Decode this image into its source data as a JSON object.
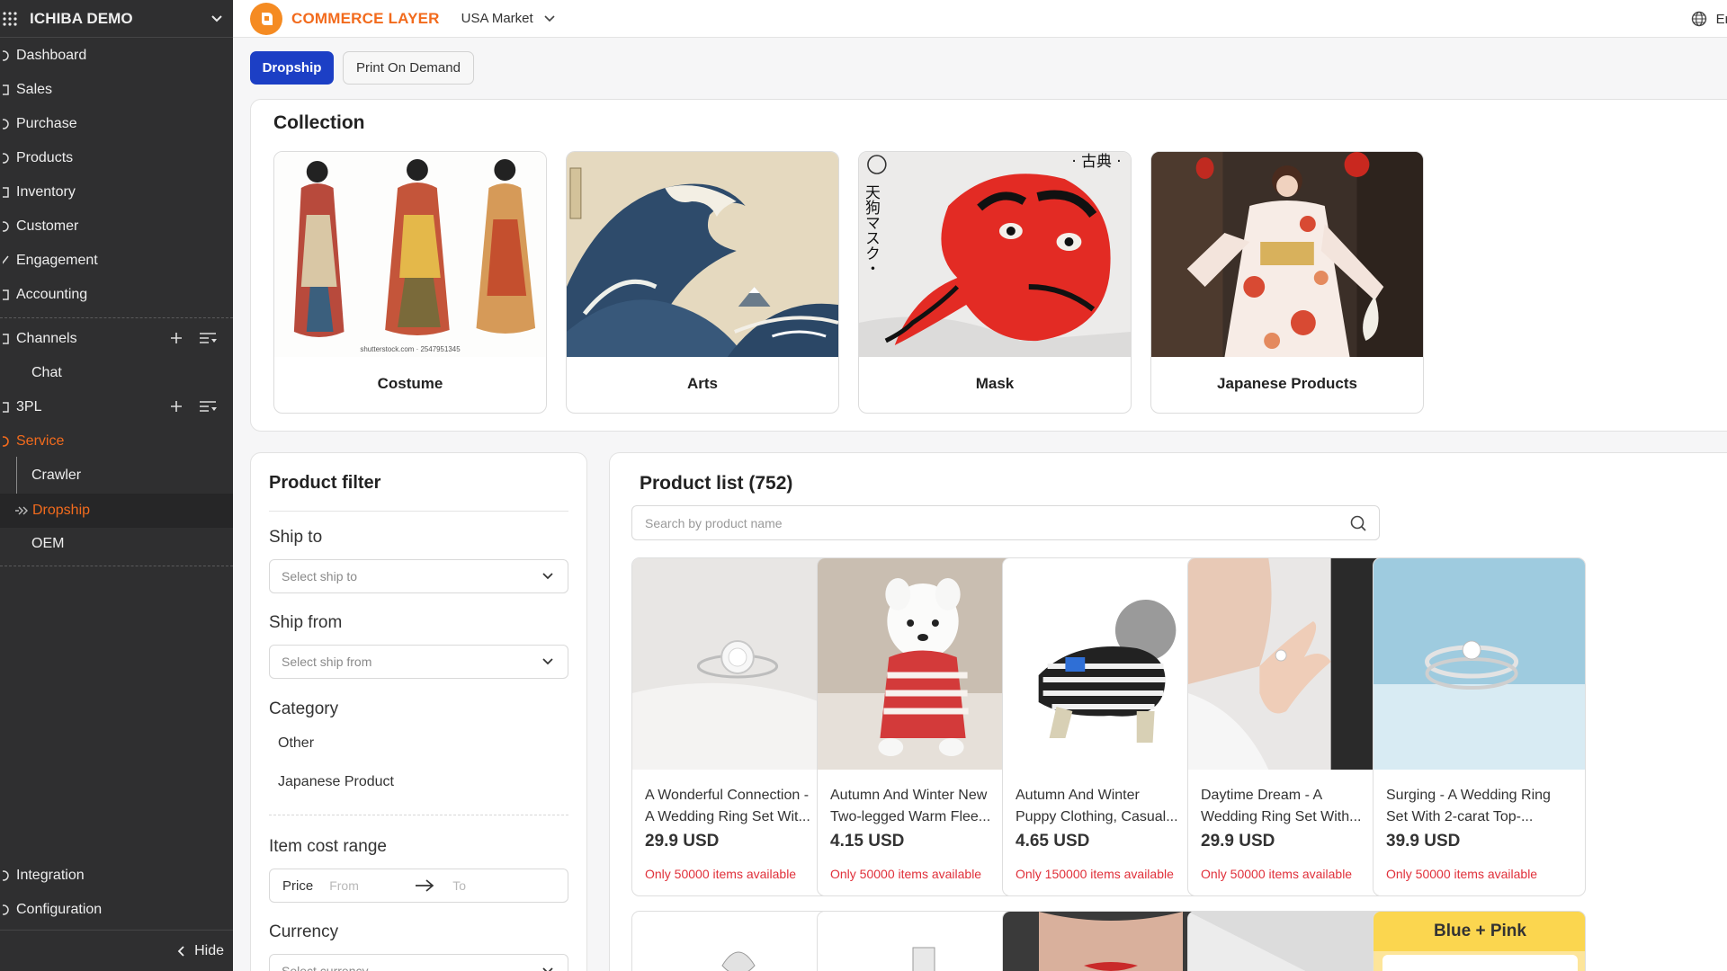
{
  "sidebar": {
    "workspace": "ICHIBA DEMO",
    "items": [
      {
        "label": "Dashboard"
      },
      {
        "label": "Sales"
      },
      {
        "label": "Purchase"
      },
      {
        "label": "Products"
      },
      {
        "label": "Inventory"
      },
      {
        "label": "Customer"
      },
      {
        "label": "Engagement"
      },
      {
        "label": "Accounting"
      }
    ],
    "channels": {
      "label": "Channels",
      "children": [
        "Chat"
      ]
    },
    "tpl": {
      "label": "3PL"
    },
    "service": {
      "label": "Service",
      "children": [
        "Crawler",
        "Dropship",
        "OEM"
      ]
    },
    "bottom": [
      {
        "label": "Integration"
      },
      {
        "label": "Configuration"
      }
    ],
    "hide_label": "Hide"
  },
  "topbar": {
    "brand": "COMMERCE LAYER",
    "market": "USA Market",
    "language": "En"
  },
  "tabs": [
    {
      "label": "Dropship",
      "active": true
    },
    {
      "label": "Print On Demand",
      "active": false
    }
  ],
  "collection": {
    "title": "Collection",
    "cards": [
      {
        "label": "Costume",
        "watermark": "shutterstock.com · 2547951345"
      },
      {
        "label": "Arts"
      },
      {
        "label": "Mask",
        "overlay_text": "· 古典 ·",
        "vertical_text": "天狗マスク・"
      },
      {
        "label": "Japanese Products"
      }
    ]
  },
  "filter": {
    "title": "Product filter",
    "ship_to": {
      "label": "Ship to",
      "placeholder": "Select ship to"
    },
    "ship_from": {
      "label": "Ship from",
      "placeholder": "Select ship from"
    },
    "category": {
      "label": "Category",
      "options": [
        "Other",
        "Japanese Product"
      ]
    },
    "cost_range": {
      "label": "Item cost range",
      "price_label": "Price",
      "from_placeholder": "From",
      "to_placeholder": "To"
    },
    "currency": {
      "label": "Currency",
      "placeholder": "Select currency"
    }
  },
  "product_list": {
    "title": "Product list (752)",
    "search_placeholder": "Search by product name",
    "products": [
      {
        "name_line1": "A Wonderful Connection -",
        "name_line2": "A Wedding Ring Set Wit...",
        "price": "29.9 USD",
        "stock": "Only 50000 items available"
      },
      {
        "name_line1": "Autumn And Winter New",
        "name_line2": "Two-legged Warm Flee...",
        "price": "4.15 USD",
        "stock": "Only 50000 items available"
      },
      {
        "name_line1": "Autumn And Winter",
        "name_line2": "Puppy Clothing, Casual...",
        "price": "4.65 USD",
        "stock": "Only 150000 items available"
      },
      {
        "name_line1": "Daytime Dream - A",
        "name_line2": "Wedding Ring Set With...",
        "price": "29.9 USD",
        "stock": "Only 50000 items available"
      },
      {
        "name_line1": "Surging - A Wedding Ring",
        "name_line2": "Set With 2-carat Top-...",
        "price": "39.9 USD",
        "stock": "Only 50000 items available"
      }
    ],
    "second_row_label": "Blue + Pink"
  }
}
